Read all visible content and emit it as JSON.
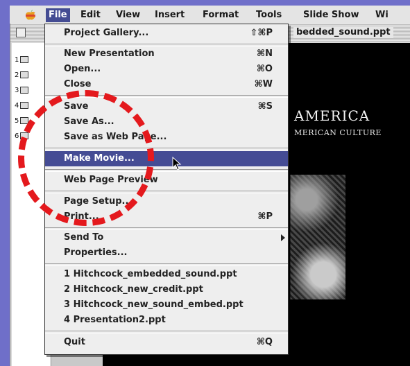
{
  "menubar": {
    "apple_icon": "apple-icon",
    "items": [
      {
        "label": "File",
        "active": true
      },
      {
        "label": "Edit"
      },
      {
        "label": "View"
      },
      {
        "label": "Insert"
      },
      {
        "label": "Format"
      },
      {
        "label": "Tools"
      },
      {
        "label": "Slide Show"
      },
      {
        "label": "Wi"
      }
    ]
  },
  "window": {
    "title": "bedded_sound.ppt",
    "slide_numbers": [
      "1",
      "2",
      "3",
      "4",
      "5",
      "6"
    ]
  },
  "slide": {
    "title": "AMERICA",
    "subtitle": "MERICAN CULTURE"
  },
  "file_menu": {
    "items": [
      {
        "label": "Project Gallery...",
        "shortcut": "⇧⌘P"
      },
      {
        "label": "New Presentation",
        "shortcut": "⌘N"
      },
      {
        "label": "Open...",
        "shortcut": "⌘O"
      },
      {
        "label": "Close",
        "shortcut": "⌘W"
      },
      {
        "label": "Save",
        "shortcut": "⌘S"
      },
      {
        "label": "Save As...",
        "shortcut": ""
      },
      {
        "label": "Save as Web Page...",
        "shortcut": ""
      },
      {
        "label": "Make Movie...",
        "shortcut": "",
        "highlighted": true
      },
      {
        "label": "Web Page Preview",
        "shortcut": ""
      },
      {
        "label": "Page Setup...",
        "shortcut": ""
      },
      {
        "label": "Print...",
        "shortcut": "⌘P"
      },
      {
        "label": "Send To",
        "shortcut": "",
        "submenu": true
      },
      {
        "label": "Properties...",
        "shortcut": ""
      },
      {
        "label": "1 Hitchcock_embedded_sound.ppt",
        "shortcut": ""
      },
      {
        "label": "2 Hitchcock_new_credit.ppt",
        "shortcut": ""
      },
      {
        "label": "3 Hitchcock_new_sound_embed.ppt",
        "shortcut": ""
      },
      {
        "label": "4 Presentation2.ppt",
        "shortcut": ""
      },
      {
        "label": "Quit",
        "shortcut": "⌘Q"
      }
    ]
  },
  "colors": {
    "desktop": "#6f6fc9",
    "highlight": "#454c94",
    "annotation_circle": "#e4191d"
  }
}
